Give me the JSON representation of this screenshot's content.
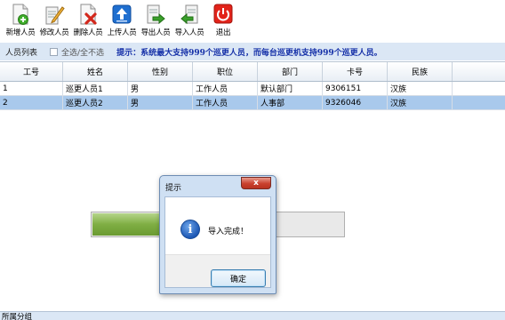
{
  "toolbar": {
    "buttons": [
      {
        "label": "新增人员",
        "icon": "add-person-icon"
      },
      {
        "label": "修改人员",
        "icon": "edit-person-icon"
      },
      {
        "label": "删除人员",
        "icon": "delete-person-icon"
      },
      {
        "label": "上传人员",
        "icon": "upload-icon"
      },
      {
        "label": "导出人员",
        "icon": "export-icon"
      },
      {
        "label": "导入人员",
        "icon": "import-icon"
      },
      {
        "label": "退出",
        "icon": "power-icon"
      }
    ]
  },
  "infobar": {
    "title": "人员列表",
    "select_all": "全选/全不选",
    "tip": "提示：系统最大支持999个巡更人员，而每台巡更机支持999个巡更人员。"
  },
  "table": {
    "headers": [
      "工号",
      "姓名",
      "性别",
      "职位",
      "部门",
      "卡号",
      "民族"
    ],
    "rows": [
      [
        "1",
        "巡更人员1",
        "男",
        "工作人员",
        "默认部门",
        "9306151",
        "汉族"
      ],
      [
        "2",
        "巡更人员2",
        "男",
        "工作人员",
        "人事部",
        "9326046",
        "汉族"
      ]
    ]
  },
  "progress": {
    "value": 0.27
  },
  "footer": {
    "label": "所属分组"
  },
  "dialog": {
    "title": "提示",
    "close": "x",
    "message": "导入完成！",
    "ok": "确定"
  },
  "colors": {
    "selected_row": "#a9c9ec",
    "tip_text": "#1530a8",
    "progress_fill": "#7fae43"
  }
}
